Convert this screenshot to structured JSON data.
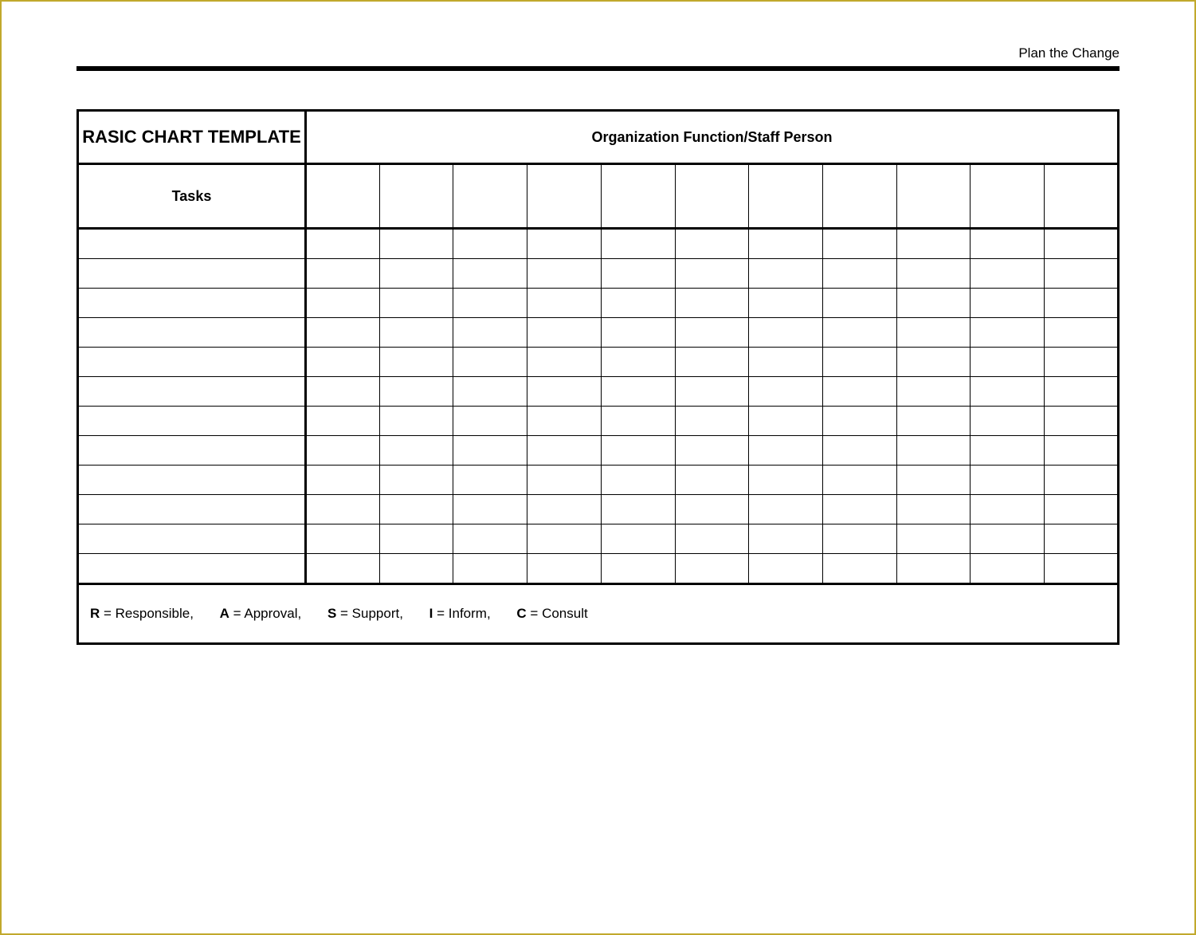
{
  "header": {
    "right_text": "Plan the Change"
  },
  "chart": {
    "title": "RASIC CHART TEMPLATE",
    "columns_header": "Organization Function/Staff Person",
    "tasks_header": "Tasks",
    "person_columns": 11,
    "task_rows": 12
  },
  "legend": {
    "items": [
      {
        "key": "R",
        "label": "Responsible,"
      },
      {
        "key": "A",
        "label": "Approval,"
      },
      {
        "key": "S",
        "label": "Support,"
      },
      {
        "key": "I",
        "label": "Inform,"
      },
      {
        "key": "C",
        "label": "Consult"
      }
    ]
  }
}
